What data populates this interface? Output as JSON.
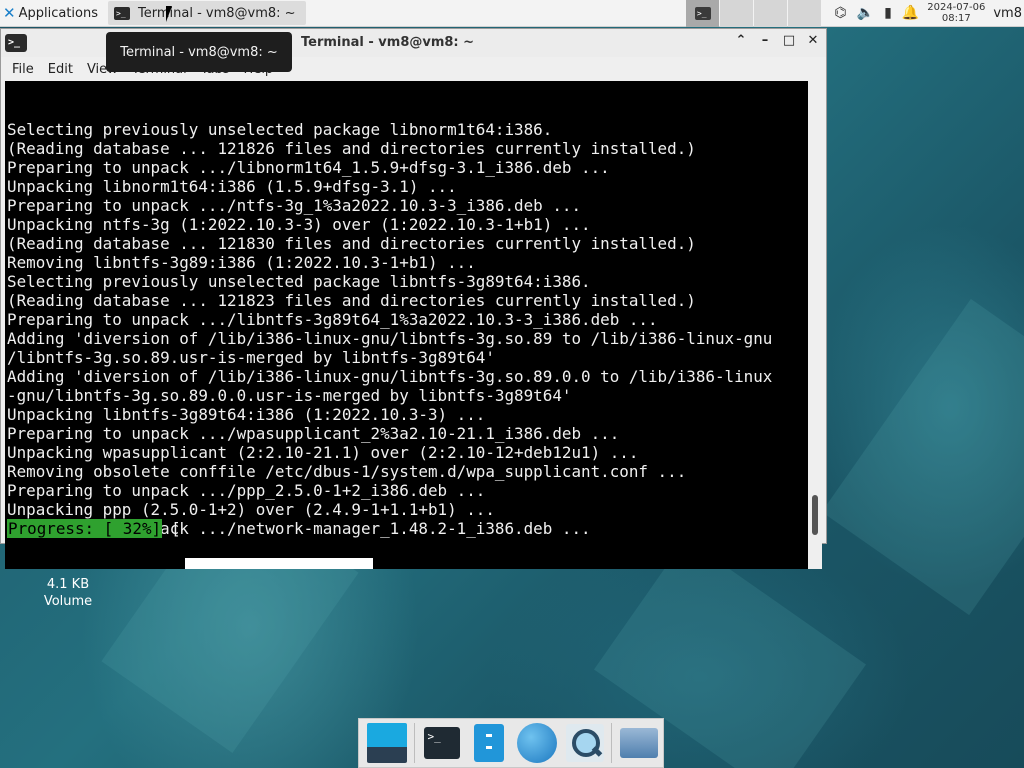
{
  "panel": {
    "apps_label": "Applications",
    "task_title": "Terminal - vm8@vm8: ~",
    "clock_date": "2024-07-06",
    "clock_time": "08:17",
    "user": "vm8"
  },
  "tooltip": {
    "text": "Terminal - vm8@vm8: ~"
  },
  "window": {
    "title": "Terminal - vm8@vm8: ~",
    "menu": [
      "File",
      "Edit",
      "View",
      "Terminal",
      "Tabs",
      "Help"
    ]
  },
  "terminal": {
    "lines": [
      "Selecting previously unselected package libnorm1t64:i386.",
      "(Reading database ... 121826 files and directories currently installed.)",
      "Preparing to unpack .../libnorm1t64_1.5.9+dfsg-3.1_i386.deb ...",
      "Unpacking libnorm1t64:i386 (1.5.9+dfsg-3.1) ...",
      "Preparing to unpack .../ntfs-3g_1%3a2022.10.3-3_i386.deb ...",
      "Unpacking ntfs-3g (1:2022.10.3-3) over (1:2022.10.3-1+b1) ...",
      "(Reading database ... 121830 files and directories currently installed.)",
      "Removing libntfs-3g89:i386 (1:2022.10.3-1+b1) ...",
      "Selecting previously unselected package libntfs-3g89t64:i386.",
      "(Reading database ... 121823 files and directories currently installed.)",
      "Preparing to unpack .../libntfs-3g89t64_1%3a2022.10.3-3_i386.deb ...",
      "Adding 'diversion of /lib/i386-linux-gnu/libntfs-3g.so.89 to /lib/i386-linux-gnu",
      "/libntfs-3g.so.89.usr-is-merged by libntfs-3g89t64'",
      "Adding 'diversion of /lib/i386-linux-gnu/libntfs-3g.so.89.0.0 to /lib/i386-linux",
      "-gnu/libntfs-3g.so.89.0.0.usr-is-merged by libntfs-3g89t64'",
      "Unpacking libntfs-3g89t64:i386 (1:2022.10.3-3) ...",
      "Preparing to unpack .../wpasupplicant_2%3a2.10-21.1_i386.deb ...",
      "Unpacking wpasupplicant (2:2.10-21.1) over (2:2.10-12+deb12u1) ...",
      "Removing obsolete conffile /etc/dbus-1/system.d/wpa_supplicant.conf ...",
      "Preparing to unpack .../ppp_2.5.0-1+2_i386.deb ...",
      "Unpacking ppp (2.5.0-1+2) over (2.4.9-1+1.1+b1) ...",
      "Preparing to unpack .../network-manager_1.48.2-1_i386.deb ..."
    ],
    "progress_label": "Progress: [ 32%]",
    "progress_fraction": 0.32,
    "bracket_open": "[",
    "bracket_close": "]"
  },
  "desktop_icon": {
    "line1": "4.1 KB",
    "line2": "Volume"
  },
  "colors": {
    "progress_green": "#2fa12f",
    "terminal_bg": "#000000",
    "desktop": "#1f5a6a"
  }
}
